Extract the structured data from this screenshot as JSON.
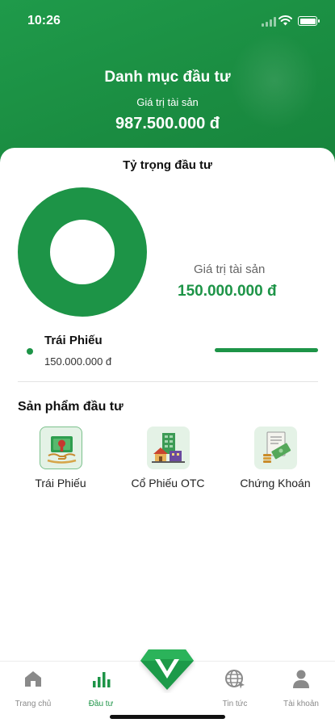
{
  "status_bar": {
    "time": "10:26"
  },
  "header": {
    "title": "Danh mục đầu tư",
    "asset_label": "Giá trị tài sản",
    "asset_value": "987.500.000 đ",
    "background_color": "#1a8c41"
  },
  "allocation": {
    "title": "Tỷ trọng đầu tư",
    "asset_label": "Giá trị tài sản",
    "asset_value": "150.000.000 đ",
    "accent_color": "#1d9447",
    "items": [
      {
        "name": "Trái Phiếu",
        "value": "150.000.000 đ",
        "share": 1.0
      }
    ]
  },
  "products": {
    "title": "Sản phẩm đầu tư",
    "items": [
      {
        "label": "Trái Phiếu",
        "icon": "bond-certificate-icon",
        "selected": true
      },
      {
        "label": "Cổ Phiếu OTC",
        "icon": "stock-building-icon",
        "selected": false
      },
      {
        "label": "Chứng Khoán",
        "icon": "securities-document-icon",
        "selected": false
      }
    ]
  },
  "bottom_nav": {
    "items": [
      {
        "label": "Trang chủ",
        "icon": "home-icon",
        "active": false
      },
      {
        "label": "Đầu tư",
        "icon": "bar-chart-icon",
        "active": true
      },
      {
        "label": "Tin tức",
        "icon": "globe-icon",
        "active": false
      },
      {
        "label": "Tài khoản",
        "icon": "user-icon",
        "active": false
      }
    ],
    "center_button_icon": "diamond-logo-icon"
  }
}
